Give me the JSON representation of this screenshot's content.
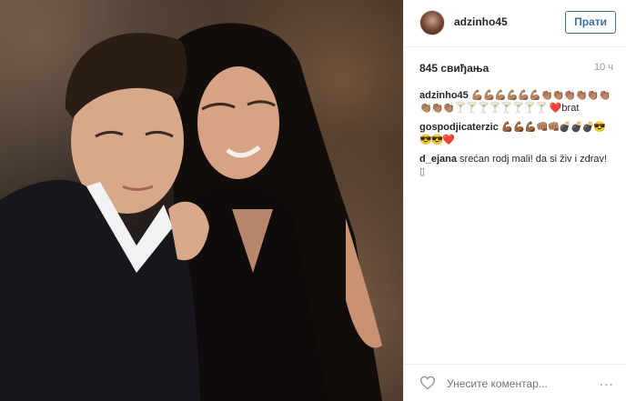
{
  "post": {
    "username": "adzinho45",
    "follow_label": "Прати",
    "likes": "845 свиђања",
    "time": "10 ч"
  },
  "comments": [
    {
      "user": "adzinho45",
      "text_a": "💪🏽💪🏽💪🏽💪🏽💪🏽💪🏽👏🏽👏🏽👏🏽👏🏽👏🏽👏🏽",
      "text_b": "👏🏽👏🏽👏🏽🍸🍸🍸🍸🍸🍸🍸🍸",
      "text_c": "❤️brat"
    },
    {
      "user": "gospodjicaterzic",
      "text_a": "💪🏾💪🏾💪🏾👊🏽👊🏽💣💣💣😎",
      "text_b": "😎😎❤️"
    },
    {
      "user": "d_ejana",
      "text_a": "srećan rodj mali! da si živ i zdrav!",
      "text_b": "▯"
    }
  ],
  "footer": {
    "comment_placeholder": "Унесите коментар...",
    "more_label": "..."
  },
  "icons": {
    "like": "heart-outline-icon",
    "more": "ellipsis-icon"
  },
  "colors": {
    "follow_accent": "#3f729b",
    "text": "#262626",
    "muted": "#999999"
  }
}
